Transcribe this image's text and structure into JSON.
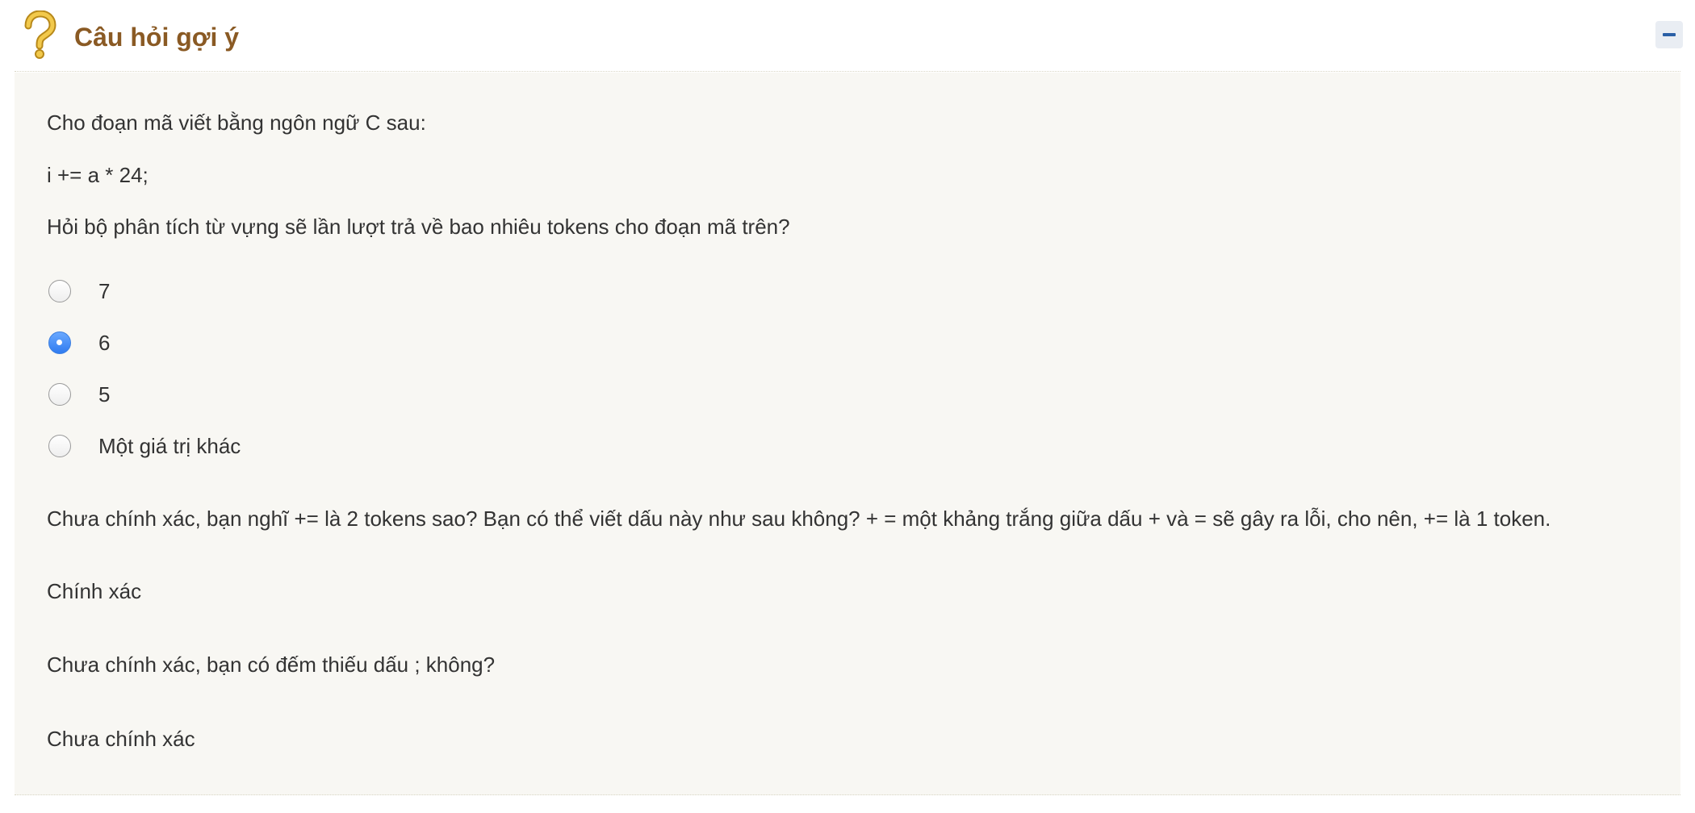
{
  "header": {
    "title": "Câu hỏi gợi ý",
    "icon": "help-question-icon",
    "collapse_icon": "minus-icon",
    "title_color": "#8a5a24"
  },
  "question": {
    "intro": "Cho đoạn mã viết bằng ngôn ngữ C sau:",
    "code": "i += a * 24;",
    "prompt": "Hỏi bộ phân tích từ vựng sẽ lần lượt trả về bao nhiêu tokens cho đoạn mã trên?",
    "options": [
      {
        "label": "7",
        "selected": false
      },
      {
        "label": "6",
        "selected": true
      },
      {
        "label": "5",
        "selected": false
      },
      {
        "label": "Một giá trị khác",
        "selected": false
      }
    ]
  },
  "feedback": [
    "Chưa chính xác, bạn nghĩ += là 2 tokens sao? Bạn có thể viết dấu này như sau không? + = một khảng trắng giữa dấu + và = sẽ gây ra lỗi, cho nên, += là 1 token.",
    "Chính xác",
    "Chưa chính xác, bạn có đếm thiếu dấu ; không?",
    "Chưa chính xác"
  ]
}
